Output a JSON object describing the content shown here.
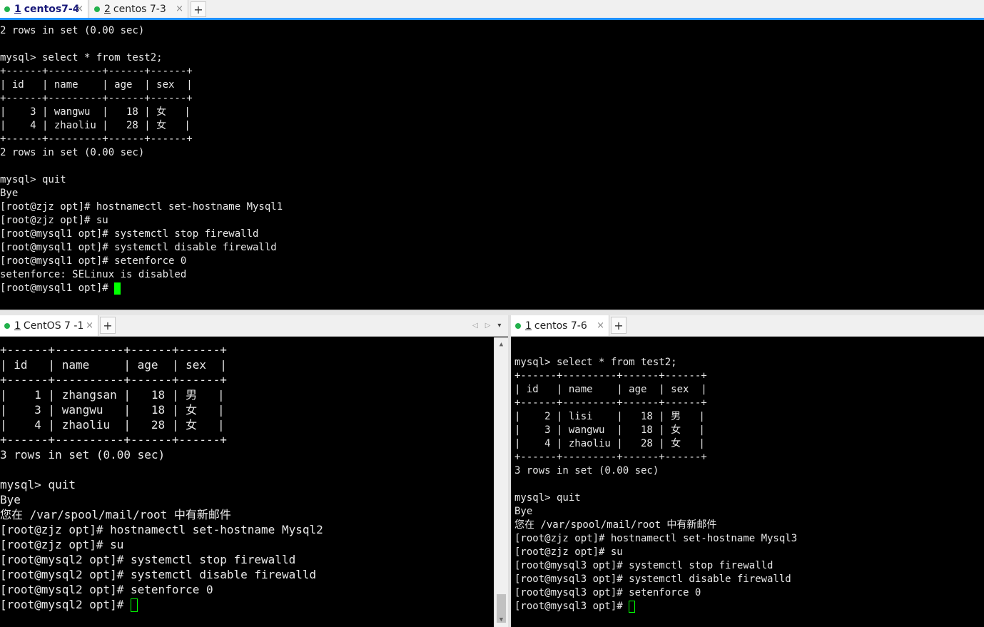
{
  "top_pane": {
    "tabs": [
      {
        "num": "1",
        "label": "centos7-4",
        "close": "×",
        "active": true
      },
      {
        "num": "2",
        "label": "centos 7-3",
        "close": "×",
        "active": false
      }
    ],
    "add_tab": "+",
    "lines": [
      "2 rows in set (0.00 sec)",
      "",
      "mysql> select * from test2;",
      "+------+---------+------+------+",
      "| id   | name    | age  | sex  |",
      "+------+---------+------+------+",
      "|    3 | wangwu  |   18 | 女   |",
      "|    4 | zhaoliu |   28 | 女   |",
      "+------+---------+------+------+",
      "2 rows in set (0.00 sec)",
      "",
      "mysql> quit",
      "Bye",
      "[root@zjz opt]# hostnamectl set-hostname Mysql1",
      "[root@zjz opt]# su",
      "[root@mysql1 opt]# systemctl stop firewalld",
      "[root@mysql1 opt]# systemctl disable firewalld",
      "[root@mysql1 opt]# setenforce 0",
      "setenforce: SELinux is disabled",
      "[root@mysql1 opt]# "
    ],
    "cursor_color": "#00ff00"
  },
  "left_pane": {
    "tabs": [
      {
        "num": "1",
        "label": "CentOS 7 -1",
        "close": "×",
        "active": true
      }
    ],
    "add_tab": "+",
    "nav_left": "◁",
    "nav_right": "▷",
    "nav_menu": "▾",
    "lines": [
      "+------+----------+------+------+",
      "| id   | name     | age  | sex  |",
      "+------+----------+------+------+",
      "|    1 | zhangsan |   18 | 男   |",
      "|    3 | wangwu   |   18 | 女   |",
      "|    4 | zhaoliu  |   28 | 女   |",
      "+------+----------+------+------+",
      "3 rows in set (0.00 sec)",
      "",
      "mysql> quit",
      "Bye",
      "您在 /var/spool/mail/root 中有新邮件",
      "[root@zjz opt]# hostnamectl set-hostname Mysql2",
      "[root@zjz opt]# su",
      "[root@mysql2 opt]# systemctl stop firewalld",
      "[root@mysql2 opt]# systemctl disable firewalld",
      "[root@mysql2 opt]# setenforce 0",
      "[root@mysql2 opt]# "
    ],
    "cursor_color": "#00ff00"
  },
  "right_pane": {
    "tabs": [
      {
        "num": "1",
        "label": "centos 7-6",
        "close": "×",
        "active": true
      }
    ],
    "add_tab": "+",
    "lines": [
      "",
      "mysql> select * from test2;",
      "+------+---------+------+------+",
      "| id   | name    | age  | sex  |",
      "+------+---------+------+------+",
      "|    2 | lisi    |   18 | 男   |",
      "|    3 | wangwu  |   18 | 女   |",
      "|    4 | zhaoliu |   28 | 女   |",
      "+------+---------+------+------+",
      "3 rows in set (0.00 sec)",
      "",
      "mysql> quit",
      "Bye",
      "您在 /var/spool/mail/root 中有新邮件",
      "[root@zjz opt]# hostnamectl set-hostname Mysql3",
      "[root@zjz opt]# su",
      "[root@mysql3 opt]# systemctl stop firewalld",
      "[root@mysql3 opt]# systemctl disable firewalld",
      "[root@mysql3 opt]# setenforce 0",
      "[root@mysql3 opt]# "
    ],
    "cursor_color": "#00ff00"
  },
  "scrollbar": {
    "up": "▲",
    "down": "▼"
  },
  "colors": {
    "tab_accent": "#1a1a7a",
    "status_dot": "#22b14c",
    "pane_border": "#1e90ff"
  }
}
